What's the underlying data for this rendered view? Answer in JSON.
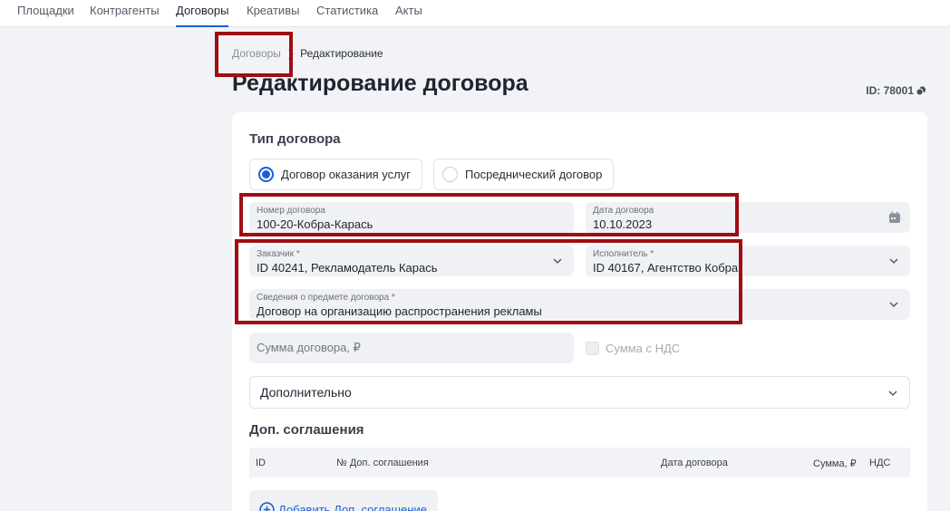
{
  "nav": {
    "tabs": [
      "Площадки",
      "Контрагенты",
      "Договоры",
      "Креативы",
      "Статистика",
      "Акты"
    ],
    "active_index": 2
  },
  "breadcrumb": {
    "parent": "Договоры",
    "current": "Редактирование"
  },
  "page": {
    "title": "Редактирование договора",
    "id_label": "ID: 78001"
  },
  "contract_type": {
    "title": "Тип договора",
    "options": [
      "Договор оказания услуг",
      "Посреднический договор"
    ],
    "selected_index": 0
  },
  "fields": {
    "number": {
      "label": "Номер договора",
      "value": "100-20-Кобра-Карась"
    },
    "date": {
      "label": "Дата договора",
      "value": "10.10.2023"
    },
    "customer": {
      "label": "Заказчик *",
      "value": "ID 40241, Рекламодатель Карась"
    },
    "executor": {
      "label": "Исполнитель *",
      "value": "ID 40167, Агентство Кобра"
    },
    "subject": {
      "label": "Сведения о предмете договора *",
      "value": "Договор на организацию распространения рекламы"
    },
    "amount": {
      "placeholder": "Сумма договора, ₽"
    },
    "vat": {
      "label": "Сумма с НДС",
      "checked": false
    }
  },
  "extra": {
    "label": "Дополнительно"
  },
  "agreements": {
    "title": "Доп. соглашения",
    "columns": [
      "ID",
      "№ Доп. соглашения",
      "Дата договора",
      "Сумма, ₽",
      "НДС"
    ],
    "add_label": "Добавить Доп. соглашение"
  },
  "colors": {
    "accent": "#1a5fd6",
    "highlight": "#a00d12",
    "field_bg": "#eff1f5"
  }
}
